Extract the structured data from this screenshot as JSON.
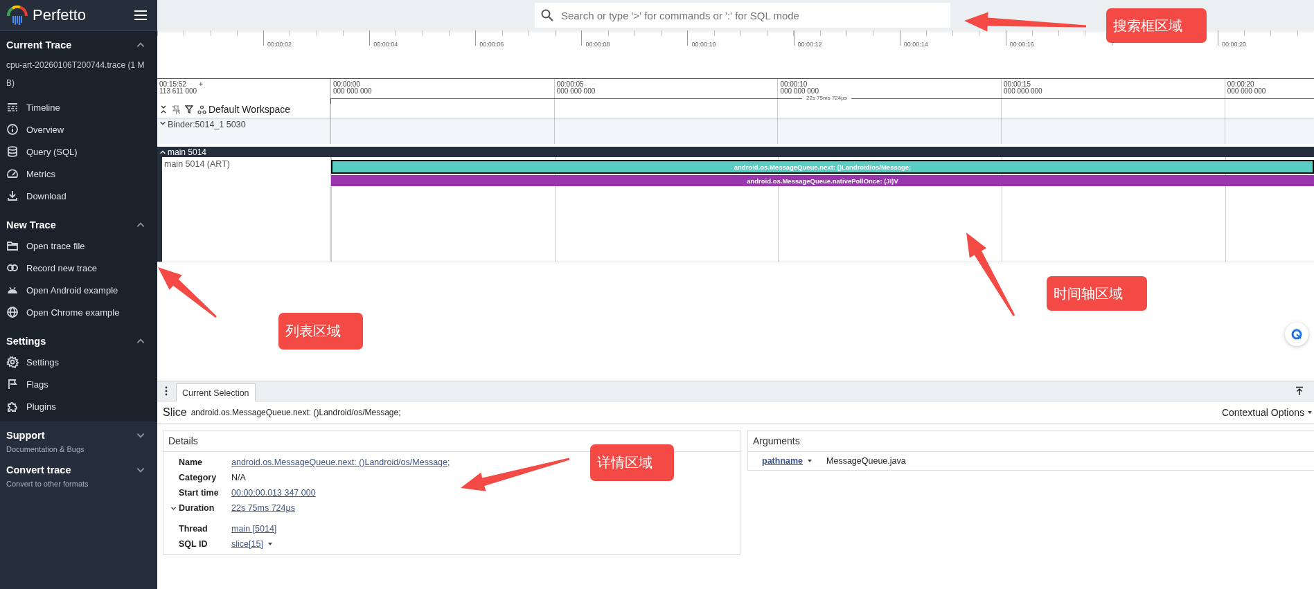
{
  "sidebar": {
    "brand": "Perfetto",
    "sections": [
      {
        "title": "Current Trace",
        "expanded": true,
        "trace_name": "cpu-art-20260106T200744.trace (1 MB)",
        "items": [
          {
            "label": "Timeline"
          },
          {
            "label": "Overview"
          },
          {
            "label": "Query (SQL)"
          },
          {
            "label": "Metrics"
          },
          {
            "label": "Download"
          }
        ]
      },
      {
        "title": "New Trace",
        "expanded": true,
        "items": [
          {
            "label": "Open trace file"
          },
          {
            "label": "Record new trace"
          },
          {
            "label": "Open Android example"
          },
          {
            "label": "Open Chrome example"
          }
        ]
      },
      {
        "title": "Settings",
        "expanded": true,
        "items": [
          {
            "label": "Settings"
          },
          {
            "label": "Flags"
          },
          {
            "label": "Plugins"
          }
        ]
      },
      {
        "title": "Support",
        "expanded": false,
        "subtitle": "Documentation & Bugs"
      },
      {
        "title": "Convert trace",
        "expanded": false,
        "subtitle": "Convert to other formats"
      }
    ]
  },
  "search": {
    "placeholder": "Search or type '>' for commands or ':' for SQL mode"
  },
  "overview_ruler": {
    "ticks": [
      {
        "kind": "labeled",
        "label": "00:00:02"
      },
      {
        "kind": "labeled",
        "label": "00:00:04"
      },
      {
        "kind": "labeled",
        "label": "00:00:06"
      },
      {
        "kind": "labeled",
        "label": "00:00:08"
      },
      {
        "kind": "labeled",
        "label": "00:00:10"
      },
      {
        "kind": "labeled",
        "label": "00:00:12"
      },
      {
        "kind": "labeled",
        "label": "00:00:14"
      },
      {
        "kind": "labeled",
        "label": "00:00:16"
      },
      {
        "kind": "covered"
      },
      {
        "kind": "labeled",
        "label": "00:00:20"
      }
    ]
  },
  "time_header": {
    "origin": {
      "time": "00:15:52",
      "sign": "+",
      "offset": "113 611 000"
    },
    "ticks": [
      {
        "time": "00:00:00",
        "sub": "000 000 000"
      },
      {
        "time": "00:00:05",
        "sub": "000 000 000"
      },
      {
        "time": "00:00:10",
        "sub": "000 000 000"
      },
      {
        "time": "00:00:15",
        "sub": "000 000 000"
      },
      {
        "time": "00:00:20",
        "sub": "000 000 000"
      }
    ],
    "span": "22s 75ms 724µs"
  },
  "workspace": {
    "name": "Default Workspace"
  },
  "tracks": [
    {
      "kind": "group",
      "name": "Binder:5014_1 5030",
      "expanded": false
    },
    {
      "kind": "group-dark",
      "name": "main 5014",
      "expanded": true,
      "children": [
        {
          "name": "main 5014 (ART)",
          "slices": [
            {
              "label": "android.os.MessageQueue.next: ()Landroid/os/Message;",
              "color": "#5acdc2",
              "selected": true
            },
            {
              "label": "android.os.MessageQueue.nativePollOnce: (JI)V",
              "color": "#9a36ad",
              "selected": false
            }
          ]
        }
      ]
    }
  ],
  "bottom_panel": {
    "tabs": [
      {
        "label": "Current Selection",
        "selected": true
      }
    ],
    "selection": {
      "type": "Slice",
      "name": "android.os.MessageQueue.next: ()Landroid/os/Message;",
      "options": "Contextual Options"
    },
    "details": {
      "title": "Details",
      "rows": [
        {
          "label": "Name",
          "value": "android.os.MessageQueue.next: ()Landroid/os/Message;",
          "kind": "link"
        },
        {
          "label": "Category",
          "value": "N/A",
          "kind": "text"
        },
        {
          "label": "Start time",
          "value": "00:00:00.013 347 000",
          "kind": "link"
        },
        {
          "label": "Duration",
          "value": "22s 75ms 724µs",
          "kind": "collapsible"
        },
        {
          "label": "Thread",
          "value": "main [5014]",
          "kind": "link"
        },
        {
          "label": "SQL ID",
          "value": "slice[15]",
          "kind": "menu-link"
        }
      ]
    },
    "arguments": {
      "title": "Arguments",
      "rows": [
        {
          "key": "pathname",
          "value": "MessageQueue.java"
        }
      ]
    }
  },
  "annotations": [
    {
      "text": "搜索框区域"
    },
    {
      "text": "列表区域"
    },
    {
      "text": "时间轴区域"
    },
    {
      "text": "详情区域"
    }
  ]
}
